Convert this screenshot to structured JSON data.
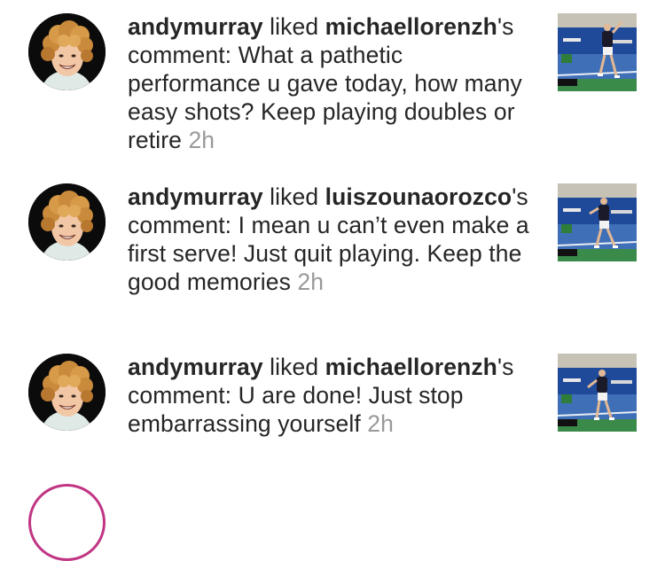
{
  "notifications": [
    {
      "actor": "andymurray",
      "action": " liked ",
      "commenter": "michaellorenzh",
      "comment_prefix": "'s comment: ",
      "comment": "What a pathetic performance u gave today, how many easy shots? Keep playing doubles or retire",
      "time": "2h",
      "avatar_icon": "profile-photo-curly-hair",
      "thumbnail_icon": "tennis-serve-photo"
    },
    {
      "actor": "andymurray",
      "action": " liked ",
      "commenter": "luiszounaorozco",
      "comment_prefix": "'s comment: ",
      "comment": "I mean u can’t even make a first serve! Just quit playing. Keep the good memories",
      "time": "2h",
      "avatar_icon": "profile-photo-curly-hair",
      "thumbnail_icon": "tennis-serve-photo"
    },
    {
      "actor": "andymurray",
      "action": " liked ",
      "commenter": "michaellorenzh",
      "comment_prefix": "'s comment: ",
      "comment": "U are done! Just stop embarrassing yourself",
      "time": "2h",
      "avatar_icon": "profile-photo-curly-hair",
      "thumbnail_icon": "tennis-serve-photo"
    }
  ],
  "colors": {
    "text": "#262626",
    "timestamp": "#999999",
    "background": "#ffffff",
    "story_ring": "#c13584"
  }
}
